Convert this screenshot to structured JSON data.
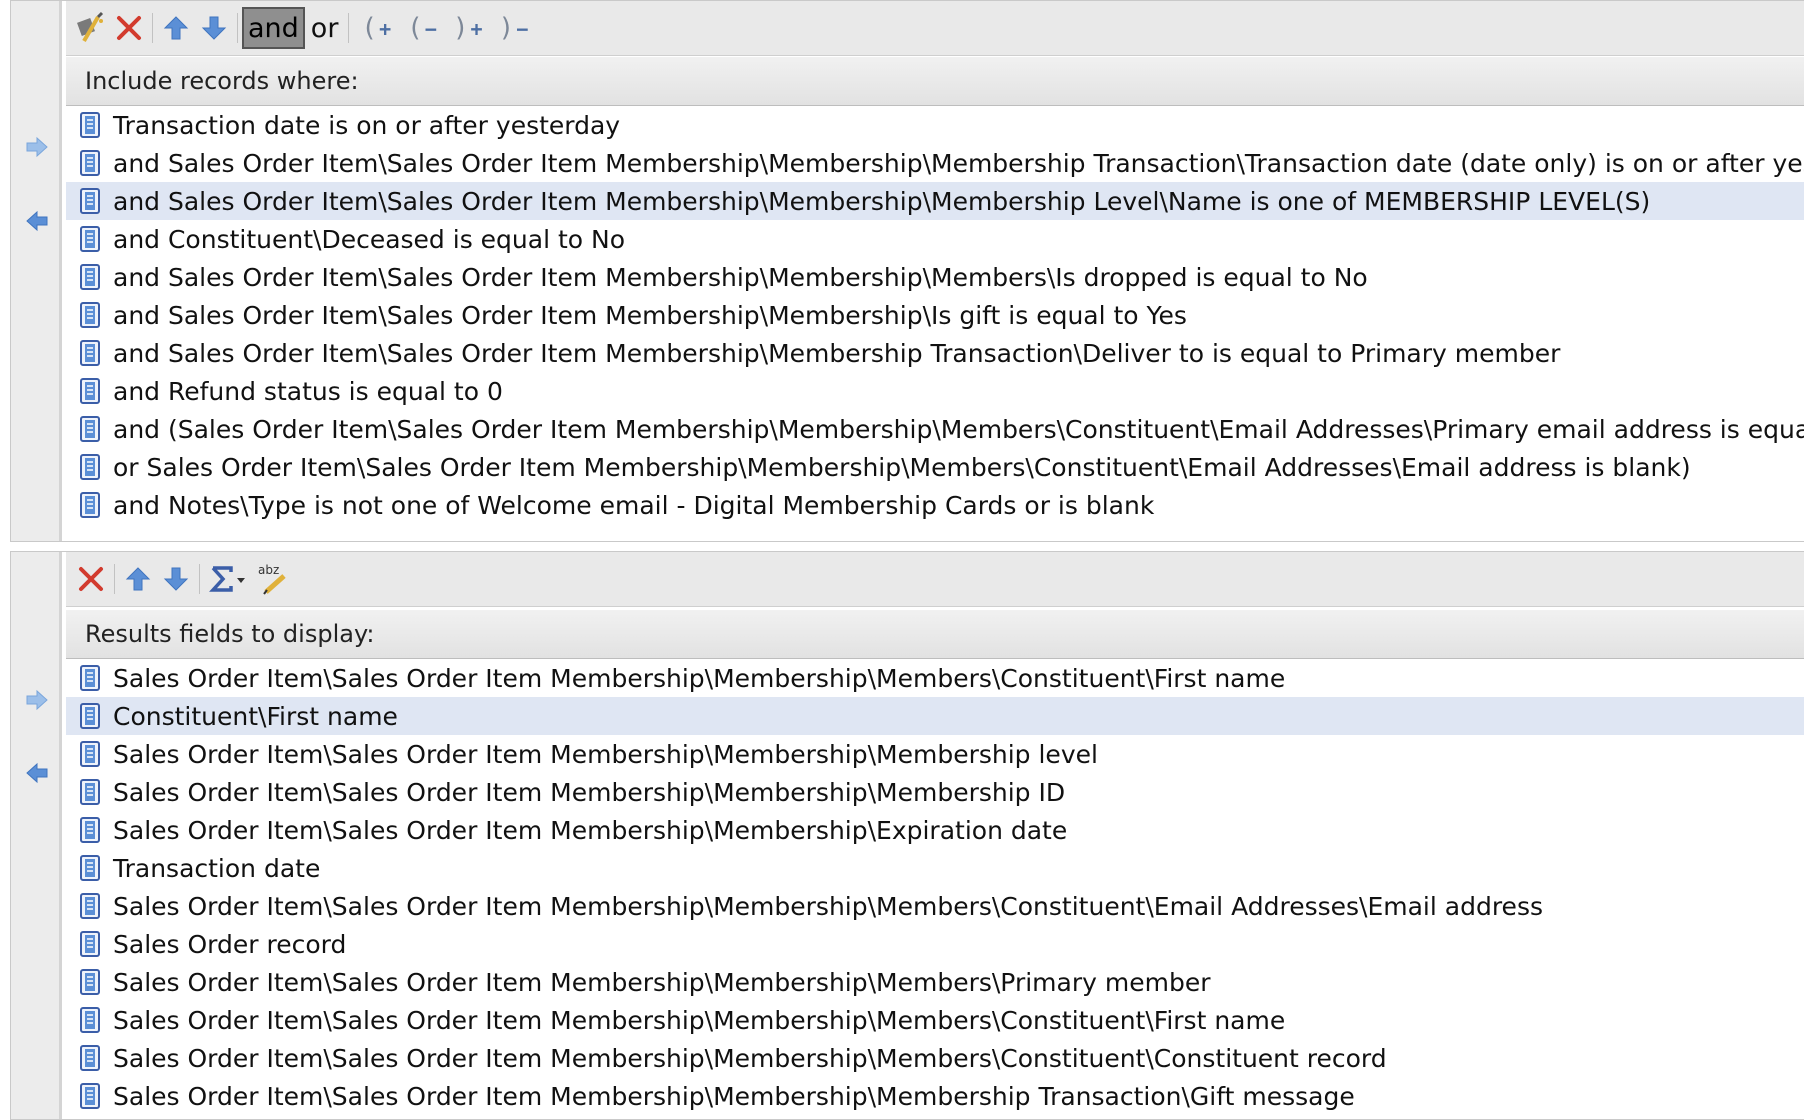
{
  "filter": {
    "toolbar": {
      "and_label": "and",
      "or_label": "or"
    },
    "header": "Include records where:",
    "rows": [
      "Transaction date is on or after yesterday",
      "and Sales Order Item\\Sales Order Item Membership\\Membership\\Membership Transaction\\Transaction date (date only) is on or after yesterday",
      "and Sales Order Item\\Sales Order Item Membership\\Membership\\Membership Level\\Name is one of MEMBERSHIP LEVEL(S)",
      "and Constituent\\Deceased is equal to No",
      "and Sales Order Item\\Sales Order Item Membership\\Membership\\Members\\Is dropped is equal to No",
      "and Sales Order Item\\Sales Order Item Membership\\Membership\\Is gift is equal to Yes",
      "and Sales Order Item\\Sales Order Item Membership\\Membership Transaction\\Deliver to is equal to Primary member",
      "and Refund status is equal to 0",
      "and (Sales Order Item\\Sales Order Item Membership\\Membership\\Members\\Constituent\\Email Addresses\\Primary email address is equal to Yes",
      "or Sales Order Item\\Sales Order Item Membership\\Membership\\Members\\Constituent\\Email Addresses\\Email address is blank)",
      "and Notes\\Type is not one of Welcome email - Digital Membership Cards or is blank"
    ],
    "selected_index": 2
  },
  "results": {
    "header": "Results fields to display:",
    "rows": [
      "Sales Order Item\\Sales Order Item Membership\\Membership\\Members\\Constituent\\First name",
      "Constituent\\First name",
      "Sales Order Item\\Sales Order Item Membership\\Membership\\Membership level",
      "Sales Order Item\\Sales Order Item Membership\\Membership\\Membership ID",
      "Sales Order Item\\Sales Order Item Membership\\Membership\\Expiration date",
      "Transaction date",
      "Sales Order Item\\Sales Order Item Membership\\Membership\\Members\\Constituent\\Email Addresses\\Email address",
      "Sales Order record",
      "Sales Order Item\\Sales Order Item Membership\\Membership\\Members\\Primary member",
      "Sales Order Item\\Sales Order Item Membership\\Membership\\Members\\Constituent\\First name",
      "Sales Order Item\\Sales Order Item Membership\\Membership\\Members\\Constituent\\Constituent record",
      "Sales Order Item\\Sales Order Item Membership\\Membership\\Membership Transaction\\Gift message"
    ],
    "selected_index": 1
  },
  "icons": {
    "row": "field-node-icon",
    "add_arrow": "arrow-right-icon",
    "remove_arrow": "arrow-left-icon"
  },
  "colors": {
    "selected_row": "#dfe6f3",
    "arrow_blue": "#5b8fd6",
    "delete_red": "#d23b2e"
  }
}
